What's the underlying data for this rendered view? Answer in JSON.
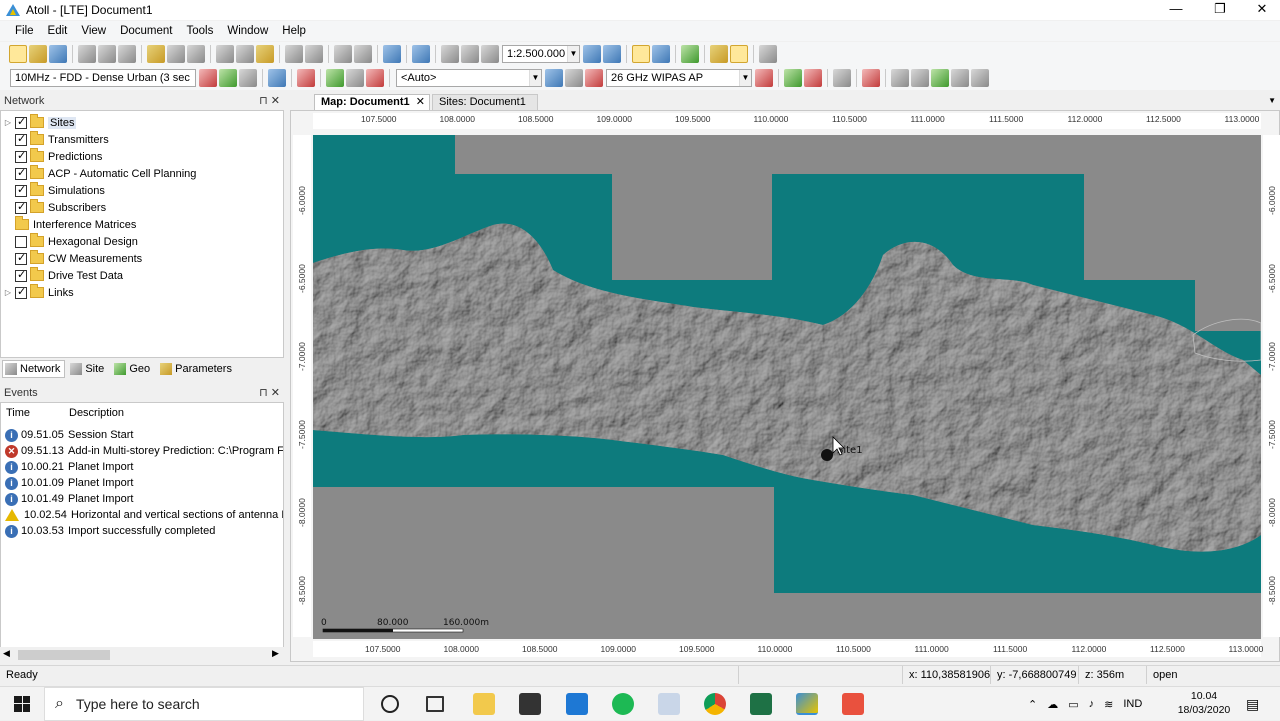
{
  "window": {
    "title": "Atoll - [LTE] Document1",
    "minimize": "—",
    "maximize": "❐",
    "close": "✕"
  },
  "menu": [
    "File",
    "Edit",
    "View",
    "Document",
    "Tools",
    "Window",
    "Help"
  ],
  "toolbar1": {
    "scale_value": "1:2.500.000"
  },
  "toolbar2": {
    "environment": "10MHz - FDD - Dense Urban (3 sec",
    "auto_combo": "<Auto>",
    "band_combo": "26 GHz WIPAS AP"
  },
  "network_panel": {
    "title": "Network",
    "items": [
      {
        "label": "Sites",
        "expandable": true,
        "checked": true
      },
      {
        "label": "Transmitters",
        "expandable": false,
        "checked": true
      },
      {
        "label": "Predictions",
        "expandable": false,
        "checked": true
      },
      {
        "label": "ACP - Automatic Cell Planning",
        "expandable": false,
        "checked": true
      },
      {
        "label": "Simulations",
        "expandable": false,
        "checked": true
      },
      {
        "label": "Subscribers",
        "expandable": false,
        "checked": true
      },
      {
        "label": "Interference Matrices",
        "expandable": false,
        "checked": null
      },
      {
        "label": "Hexagonal Design",
        "expandable": false,
        "checked": false
      },
      {
        "label": "CW Measurements",
        "expandable": false,
        "checked": true
      },
      {
        "label": "Drive Test Data",
        "expandable": false,
        "checked": true
      },
      {
        "label": "Links",
        "expandable": true,
        "checked": true
      }
    ],
    "tabs": [
      "Network",
      "Site",
      "Geo",
      "Parameters"
    ]
  },
  "events_panel": {
    "title": "Events",
    "col_time": "Time",
    "col_desc": "Description",
    "rows": [
      {
        "type": "info",
        "time": "09.51.05",
        "desc": "Session Start"
      },
      {
        "type": "err",
        "time": "09.51.13",
        "desc": "Add-in Multi-storey Prediction: C:\\Program F"
      },
      {
        "type": "info",
        "time": "10.00.21",
        "desc": "Planet Import"
      },
      {
        "type": "info",
        "time": "10.01.09",
        "desc": "Planet Import"
      },
      {
        "type": "info",
        "time": "10.01.49",
        "desc": "Planet Import"
      },
      {
        "type": "warn",
        "time": "10.02.54",
        "desc": "Horizontal and vertical sections of antenna L"
      },
      {
        "type": "info",
        "time": "10.03.53",
        "desc": "Import successfully completed"
      }
    ]
  },
  "doc_tabs": [
    {
      "label": "Map: Document1",
      "active": true
    },
    {
      "label": "Sites: Document1",
      "active": false
    }
  ],
  "map": {
    "x_ticks": [
      "107.5000",
      "108.0000",
      "108.5000",
      "109.0000",
      "109.5000",
      "110.0000",
      "110.5000",
      "111.0000",
      "111.5000",
      "112.0000",
      "112.5000",
      "113.0000"
    ],
    "y_ticks": [
      "-6.0000",
      "-6.5000",
      "-7.0000",
      "-7.5000",
      "-8.0000",
      "-8.5000"
    ],
    "scalebar": {
      "zero": "0",
      "mid": "80.000",
      "end": "160.000m"
    },
    "site_label": "Site1",
    "colors": {
      "sea": "#0d7b7d",
      "land": "#7f7f7f",
      "background": "#8a8a8a"
    }
  },
  "statusbar": {
    "ready": "Ready",
    "x": "x: 110,38581906",
    "y": "y: -7,668800749",
    "z": "z: 356m",
    "state": "open"
  },
  "taskbar": {
    "search_placeholder": "Type here to search",
    "lang": "IND",
    "time": "10.04",
    "date": "18/03/2020"
  }
}
